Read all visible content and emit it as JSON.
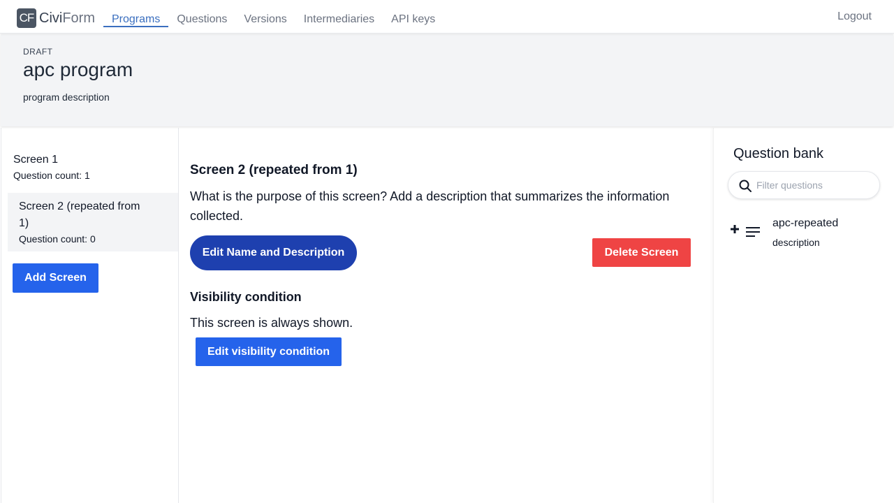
{
  "nav": {
    "logo_mark": "CF",
    "logo_bold": "Civi",
    "logo_light": "Form",
    "links": [
      "Programs",
      "Questions",
      "Versions",
      "Intermediaries",
      "API keys"
    ],
    "active_link": "Programs",
    "logout": "Logout"
  },
  "program": {
    "status": "DRAFT",
    "name": "apc program",
    "description": "program description"
  },
  "screens": [
    {
      "name": "Screen 1",
      "count": "Question count: 1",
      "selected": false
    },
    {
      "name": "Screen 2 (repeated from 1)",
      "count": "Question count: 0",
      "selected": true
    }
  ],
  "add_screen_label": "Add Screen",
  "main": {
    "title": "Screen 2 (repeated from 1)",
    "description": "What is the purpose of this screen? Add a description that summarizes the information collected.",
    "edit_name_label": "Edit Name and Description",
    "delete_label": "Delete Screen",
    "visibility_title": "Visibility condition",
    "visibility_text": "This screen is always shown.",
    "edit_visibility_label": "Edit visibility condition"
  },
  "question_bank": {
    "title": "Question bank",
    "filter_placeholder": "Filter questions",
    "questions": [
      {
        "name": "apc-repeated",
        "description": "description",
        "icon": "text-icon"
      }
    ]
  },
  "colors": {
    "primary": "#2563eb",
    "primary_dark": "#1e40af",
    "danger": "#ef4444",
    "nav_active": "#3b6fbf",
    "panel_bg": "#f3f4f6"
  }
}
